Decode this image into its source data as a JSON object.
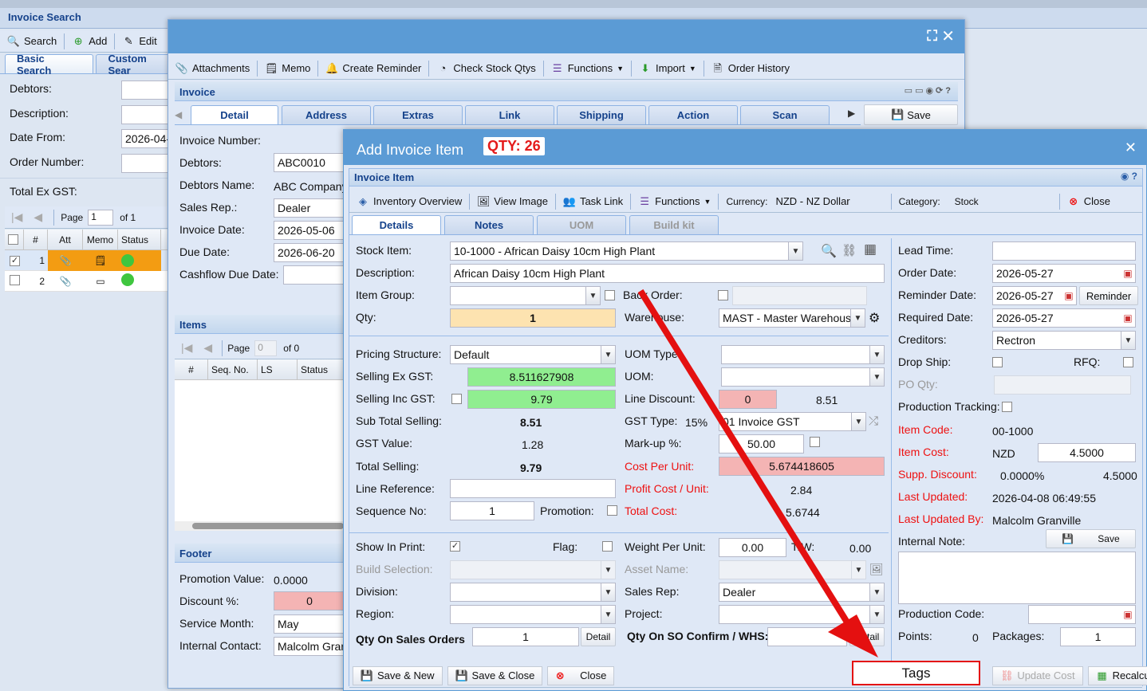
{
  "invoice_search": {
    "title": "Invoice Search",
    "toolbar": {
      "search": "Search",
      "add": "Add",
      "edit": "Edit"
    },
    "tabs": [
      "Basic Search",
      "Custom Sear"
    ],
    "fields": {
      "debtors": "Debtors:",
      "description": "Description:",
      "date_from": "Date From:",
      "date_from_value": "2026-04-",
      "order_number": "Order Number:",
      "total_ex_gst": "Total Ex GST:"
    },
    "pager": {
      "page_label": "Page",
      "page": "1",
      "of": "of 1"
    },
    "grid_columns": [
      "#",
      "Att",
      "Memo",
      "Status"
    ],
    "rows": [
      {
        "num": "1",
        "checked": true,
        "highlight": "#f39c12"
      },
      {
        "num": "2",
        "checked": false,
        "highlight": ""
      }
    ]
  },
  "invoice": {
    "toolbar": {
      "attachments": "Attachments",
      "memo": "Memo",
      "create_reminder": "Create Reminder",
      "check_stock": "Check Stock Qtys",
      "functions": "Functions",
      "import": "Import",
      "order_history": "Order History"
    },
    "header": "Invoice",
    "tabs": [
      "Detail",
      "Address",
      "Extras",
      "Link",
      "Shipping",
      "Action",
      "Scan"
    ],
    "save": "Save",
    "fields": {
      "invoice_number": "Invoice Number:",
      "debtors": "Debtors:",
      "debtors_value": "ABC0010",
      "debtors_name": "Debtors Name:",
      "debtors_name_value": "ABC Company",
      "sales_rep": "Sales Rep.:",
      "sales_rep_value": "Dealer",
      "invoice_date": "Invoice Date:",
      "invoice_date_value": "2026-05-06",
      "due_date": "Due Date:",
      "due_date_value": "2026-06-20",
      "cashflow": "Cashflow Due Date:"
    },
    "items": {
      "header": "Items",
      "pager_page": "Page",
      "pager_value": "0",
      "pager_of": "of 0",
      "columns": [
        "#",
        "Seq. No.",
        "LS",
        "Status"
      ]
    },
    "footer": {
      "header": "Footer",
      "promotion_value": "Promotion Value:",
      "promotion_value_v": "0.0000",
      "discount": "Discount %:",
      "discount_v": "0",
      "service_month": "Service Month:",
      "service_month_v": "May",
      "internal_contact": "Internal Contact:",
      "internal_contact_v": "Malcolm Granv"
    }
  },
  "add_item": {
    "title": "Add Invoice Item",
    "qty_badge": "QTY: 26",
    "panel_title": "Invoice Item",
    "toolbar": {
      "inventory_overview": "Inventory Overview",
      "view_image": "View Image",
      "task_link": "Task Link",
      "functions": "Functions",
      "currency_label": "Currency:",
      "currency_value": "NZD - NZ Dollar",
      "category_label": "Category:",
      "category_value": "Stock",
      "close": "Close"
    },
    "tabs": [
      "Details",
      "Notes",
      "UOM",
      "Build kit"
    ],
    "left": {
      "stock_item": "Stock Item:",
      "stock_item_v": "10-1000 - African Daisy 10cm High Plant",
      "description": "Description:",
      "description_v": "African Daisy 10cm High Plant",
      "item_group": "Item Group:",
      "back_order": "Back Order:",
      "qty": "Qty:",
      "qty_v": "1",
      "warehouse": "Warehouse:",
      "warehouse_v": "MAST - Master Warehouse",
      "pricing_structure": "Pricing Structure:",
      "pricing_structure_v": "Default",
      "uom_type": "UOM Type:",
      "selling_ex_gst": "Selling Ex GST:",
      "selling_ex_gst_v": "8.511627908",
      "uom": "UOM:",
      "selling_inc_gst": "Selling Inc GST:",
      "selling_inc_gst_v": "9.79",
      "line_discount": "Line Discount:",
      "line_discount_v": "0",
      "line_discount_amt": "8.51",
      "sub_total": "Sub Total Selling:",
      "sub_total_v": "8.51",
      "gst_type": "GST Type:",
      "gst_pct": "15%",
      "gst_type_v": "01 Invoice GST",
      "gst_value": "GST Value:",
      "gst_value_v": "1.28",
      "markup": "Mark-up %:",
      "markup_v": "50.00",
      "total_selling": "Total Selling:",
      "total_selling_v": "9.79",
      "cost_per_unit": "Cost Per Unit:",
      "cost_per_unit_v": "5.674418605",
      "line_reference": "Line Reference:",
      "profit_cost": "Profit Cost / Unit:",
      "profit_cost_v": "2.84",
      "sequence_no": "Sequence No:",
      "sequence_no_v": "1",
      "promotion": "Promotion:",
      "total_cost": "Total Cost:",
      "total_cost_v": "5.6744",
      "show_in_print": "Show In Print:",
      "flag": "Flag:",
      "weight_per_unit": "Weight Per Unit:",
      "weight_v": "0.00",
      "tw": "T/W:",
      "tw_v": "0.00",
      "build_selection": "Build Selection:",
      "asset_name": "Asset Name:",
      "division": "Division:",
      "sales_rep": "Sales Rep:",
      "sales_rep_v": "Dealer",
      "region": "Region:",
      "project": "Project:",
      "qty_on_sales_orders": "Qty On Sales Orders",
      "qty_on_sales_orders_v": "1",
      "detail": "Detail",
      "qty_on_so_confirm": "Qty On SO Confirm / WHS:"
    },
    "right": {
      "lead_time": "Lead Time:",
      "order_date": "Order Date:",
      "order_date_v": "2026-05-27",
      "reminder_date": "Reminder Date:",
      "reminder_date_v": "2026-05-27",
      "reminder_btn": "Reminder",
      "required_date": "Required Date:",
      "required_date_v": "2026-05-27",
      "creditors": "Creditors:",
      "creditors_v": "Rectron",
      "drop_ship": "Drop Ship:",
      "rfq": "RFQ:",
      "po_qty": "PO Qty:",
      "production_tracking": "Production Tracking:",
      "item_code": "Item Code:",
      "item_code_v": "00-1000",
      "item_cost": "Item Cost:",
      "item_cost_cur": "NZD",
      "item_cost_v": "4.5000",
      "supp_discount": "Supp. Discount:",
      "supp_discount_pct": "0.0000%",
      "supp_discount_v": "4.5000",
      "last_updated": "Last Updated:",
      "last_updated_v": "2026-04-08 06:49:55",
      "last_updated_by": "Last Updated By:",
      "last_updated_by_v": "Malcolm Granville",
      "internal_note": "Internal Note:",
      "save": "Save",
      "production_code": "Production Code:",
      "points": "Points:",
      "points_v": "0",
      "packages": "Packages:",
      "packages_v": "1"
    },
    "footer": {
      "save_new": "Save & New",
      "save_close": "Save & Close",
      "close": "Close",
      "tags": "Tags",
      "update_cost": "Update Cost",
      "recalculate": "Recalculate"
    }
  },
  "colors": {
    "header_blue": "#5b9bd5",
    "qty_badge": "#e41b1b",
    "annotation_red": "#e41010",
    "green_field": "#90ee90",
    "pink_field": "#f4b4b4",
    "orange_field": "#fde3b0"
  }
}
